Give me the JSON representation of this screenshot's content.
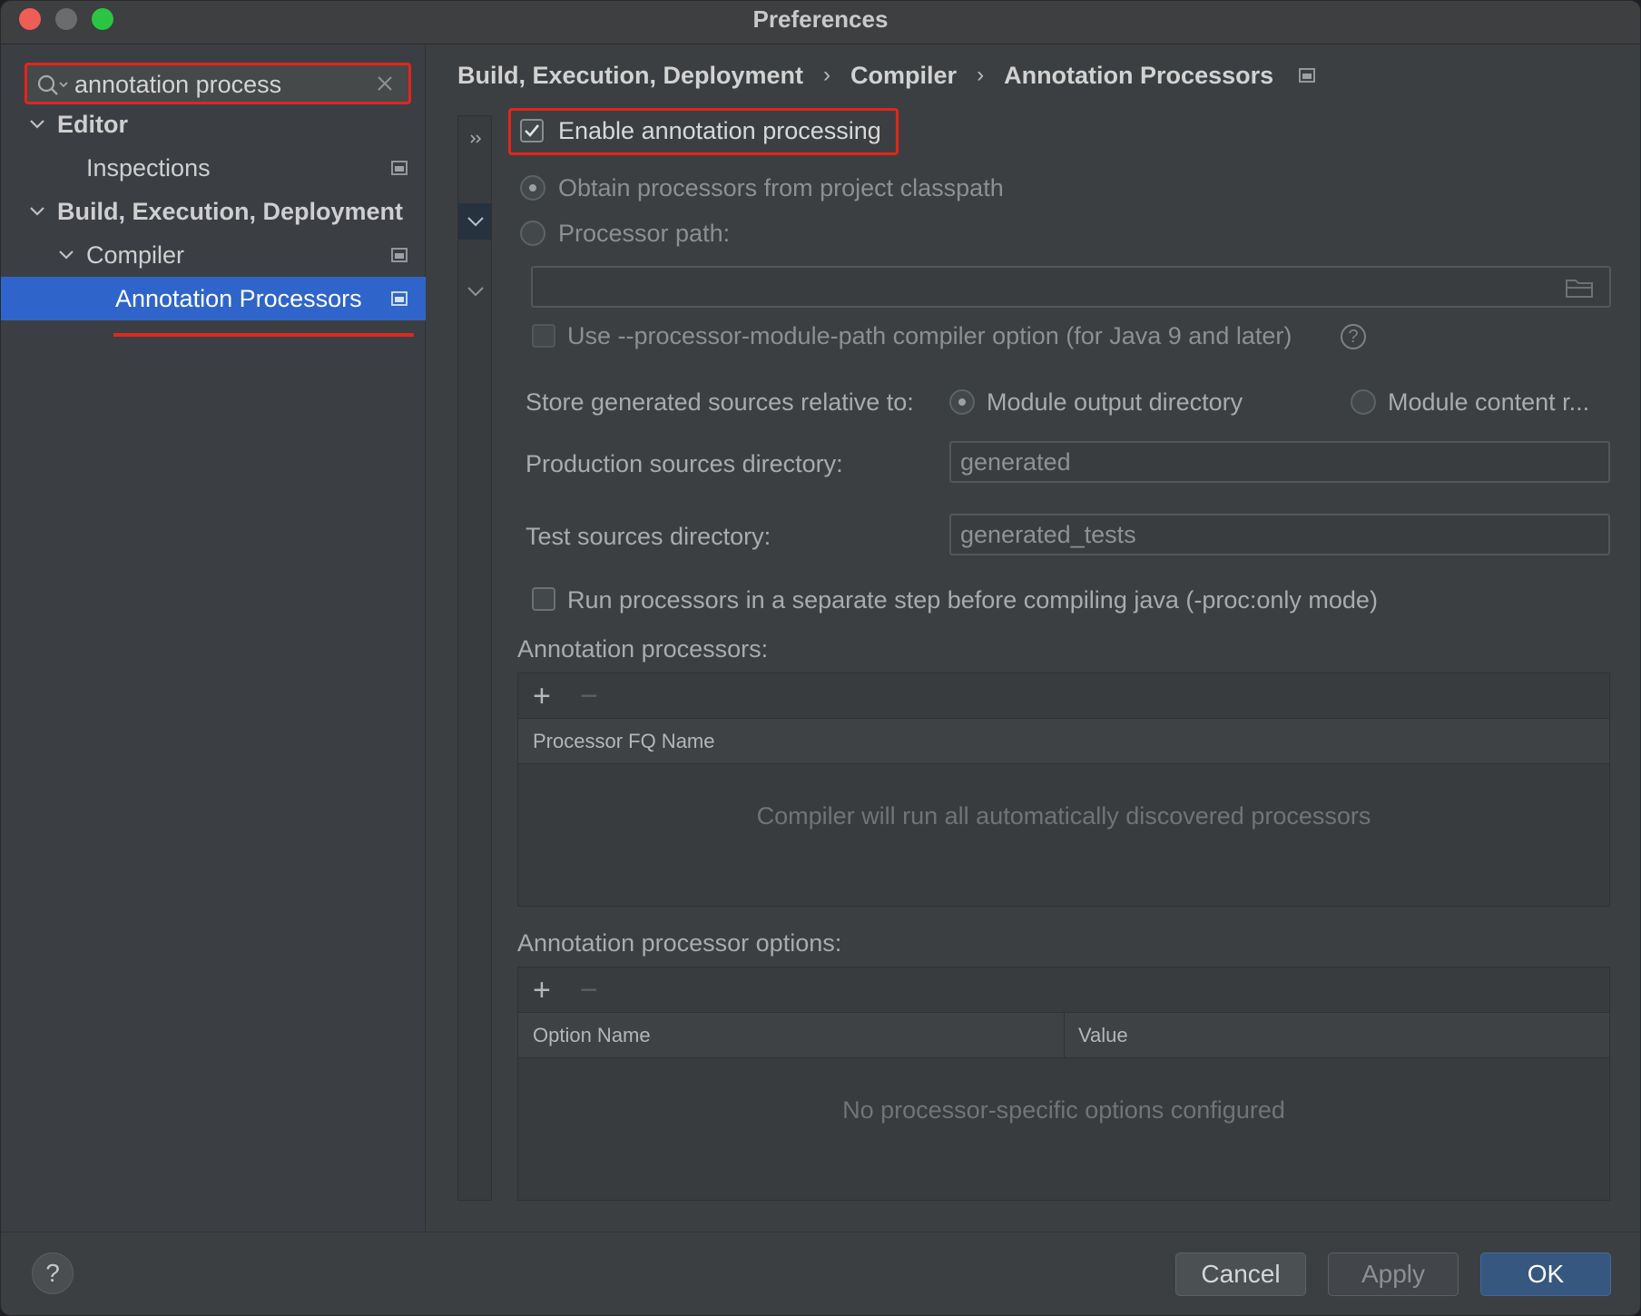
{
  "window": {
    "title": "Preferences"
  },
  "search": {
    "value": "annotation process",
    "clear_icon": "close-icon",
    "search_icon": "search-icon"
  },
  "sidebar": {
    "items": [
      {
        "label": "Editor",
        "expanded": true,
        "bold": true
      },
      {
        "label": "Inspections",
        "project_icon": true
      },
      {
        "label": "Build, Execution, Deployment",
        "expanded": true,
        "bold": true
      },
      {
        "label": "Compiler",
        "expanded": true,
        "project_icon": true
      },
      {
        "label": "Annotation Processors",
        "selected": true,
        "project_icon": true
      }
    ]
  },
  "breadcrumb": {
    "items": [
      "Build, Execution, Deployment",
      "Compiler",
      "Annotation Processors"
    ],
    "separator": "›"
  },
  "settings": {
    "enable_label": "Enable annotation processing",
    "enable_checked": true,
    "obtain_label": "Obtain processors from project classpath",
    "obtain_selected": true,
    "processor_path_label": "Processor path:",
    "processor_path_value": "",
    "module_path_label": "Use --processor-module-path compiler option (for Java 9 and later)",
    "module_path_checked": false,
    "store_label": "Store generated sources relative to:",
    "store_option1": "Module output directory",
    "store_option2": "Module content r...",
    "store_selected": "Module output directory",
    "production_label": "Production sources directory:",
    "production_value": "generated",
    "test_label": "Test sources directory:",
    "test_value": "generated_tests",
    "separate_step_label": "Run processors in a separate step before compiling java (-proc:only mode)",
    "separate_step_checked": false
  },
  "processors_panel": {
    "title": "Annotation processors:",
    "add": "+",
    "remove": "−",
    "column": "Processor FQ Name",
    "empty_text": "Compiler will run all automatically discovered processors"
  },
  "options_panel": {
    "title": "Annotation processor options:",
    "add": "+",
    "remove": "−",
    "columns": [
      "Option Name",
      "Value"
    ],
    "empty_text": "No processor-specific options configured"
  },
  "buttons": {
    "help": "?",
    "cancel": "Cancel",
    "apply": "Apply",
    "ok": "OK"
  },
  "colors": {
    "selection": "#2f65ca",
    "highlight": "#e1261c",
    "ok_button": "#365880"
  }
}
